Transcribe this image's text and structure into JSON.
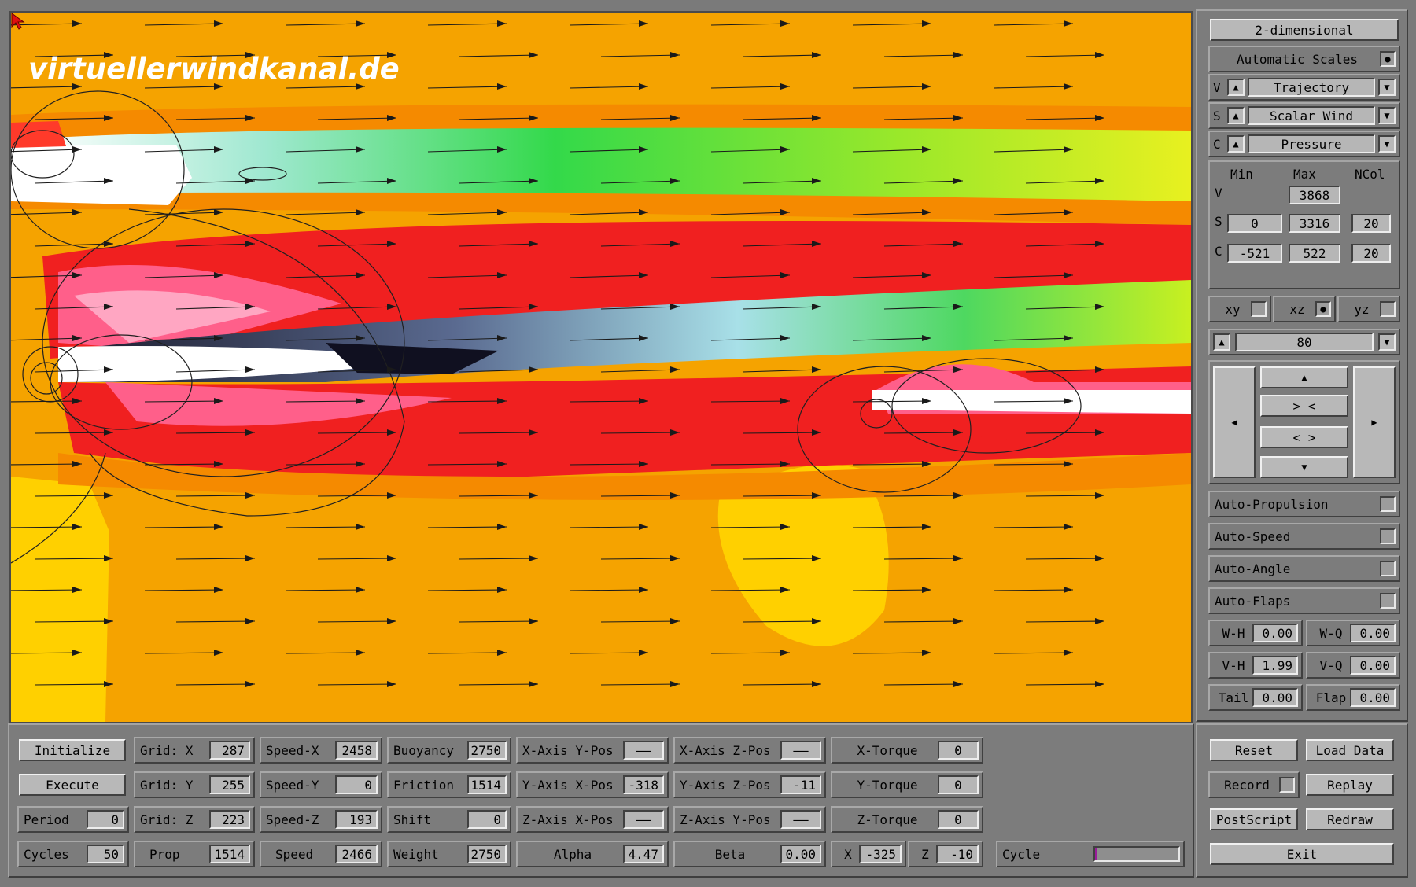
{
  "watermark": "virtuellerwindkanal.de",
  "right_panel": {
    "mode": "2-dimensional",
    "auto_scales": {
      "label": "Automatic Scales",
      "checked": true
    },
    "selectors": [
      {
        "key": "V",
        "value": "Trajectory"
      },
      {
        "key": "S",
        "value": "Scalar Wind"
      },
      {
        "key": "C",
        "value": "Pressure"
      }
    ],
    "range_headers": {
      "min": "Min",
      "max": "Max",
      "ncol": "NCol"
    },
    "ranges": {
      "v": {
        "label": "V",
        "max": "3868"
      },
      "s": {
        "label": "S",
        "min": "0",
        "max": "3316",
        "ncol": "20"
      },
      "c": {
        "label": "C",
        "min": "-521",
        "max": "522",
        "ncol": "20"
      }
    },
    "planes": [
      {
        "label": "xy",
        "checked": false
      },
      {
        "label": "xz",
        "checked": true
      },
      {
        "label": "yz",
        "checked": false
      }
    ],
    "slice_value": "80",
    "nav": {
      "zoom_in": "> <",
      "zoom_out": "< >",
      "up": "▲",
      "down": "▼",
      "left": "◀",
      "right": "▶"
    },
    "autos": [
      {
        "label": "Auto-Propulsion",
        "checked": false
      },
      {
        "label": "Auto-Speed",
        "checked": false
      },
      {
        "label": "Auto-Angle",
        "checked": false
      },
      {
        "label": "Auto-Flaps",
        "checked": false
      }
    ],
    "params": [
      [
        {
          "label": "W-H",
          "value": "0.00"
        },
        {
          "label": "W-Q",
          "value": "0.00"
        }
      ],
      [
        {
          "label": "V-H",
          "value": "1.99"
        },
        {
          "label": "V-Q",
          "value": "0.00"
        }
      ],
      [
        {
          "label": "Tail",
          "value": "0.00"
        },
        {
          "label": "Flap",
          "value": "0.00"
        }
      ]
    ]
  },
  "bottom_panel": {
    "initialize": "Initialize",
    "execute": "Execute",
    "period": {
      "label": "Period",
      "value": "0"
    },
    "cycles": {
      "label": "Cycles",
      "value": "50"
    },
    "grid": [
      {
        "label": "Grid: X",
        "value": "287"
      },
      {
        "label": "Grid: Y",
        "value": "255"
      },
      {
        "label": "Grid: Z",
        "value": "223"
      }
    ],
    "prop": {
      "label": "Prop",
      "value": "1514"
    },
    "speeds": [
      {
        "label": "Speed-X",
        "value": "2458"
      },
      {
        "label": "Speed-Y",
        "value": "0"
      },
      {
        "label": "Speed-Z",
        "value": "193"
      },
      {
        "label": "Speed",
        "value": "2466"
      }
    ],
    "physics": [
      {
        "label": "Buoyancy",
        "value": "2750"
      },
      {
        "label": "Friction",
        "value": "1514"
      },
      {
        "label": "Shift",
        "value": "0"
      },
      {
        "label": "Weight",
        "value": "2750"
      }
    ],
    "axis_a": [
      {
        "label": "X-Axis Y-Pos",
        "value": "——"
      },
      {
        "label": "Y-Axis X-Pos",
        "value": "-318"
      },
      {
        "label": "Z-Axis X-Pos",
        "value": "——"
      }
    ],
    "axis_b": [
      {
        "label": "X-Axis Z-Pos",
        "value": "——"
      },
      {
        "label": "Y-Axis Z-Pos",
        "value": "-11"
      },
      {
        "label": "Z-Axis Y-Pos",
        "value": "——"
      }
    ],
    "torques": [
      {
        "label": "X-Torque",
        "value": "0"
      },
      {
        "label": "Y-Torque",
        "value": "0"
      },
      {
        "label": "Z-Torque",
        "value": "0"
      }
    ],
    "alpha": {
      "label": "Alpha",
      "value": "4.47"
    },
    "beta": {
      "label": "Beta",
      "value": "0.00"
    },
    "x": {
      "label": "X",
      "value": "-325"
    },
    "z": {
      "label": "Z",
      "value": "-10"
    },
    "cycle": {
      "label": "Cycle",
      "progress": 0.03
    }
  },
  "bottom_right": {
    "reset": "Reset",
    "load_data": "Load Data",
    "record": {
      "label": "Record",
      "checked": false
    },
    "replay": "Replay",
    "postscript": "PostScript",
    "redraw": "Redraw",
    "exit": "Exit"
  }
}
